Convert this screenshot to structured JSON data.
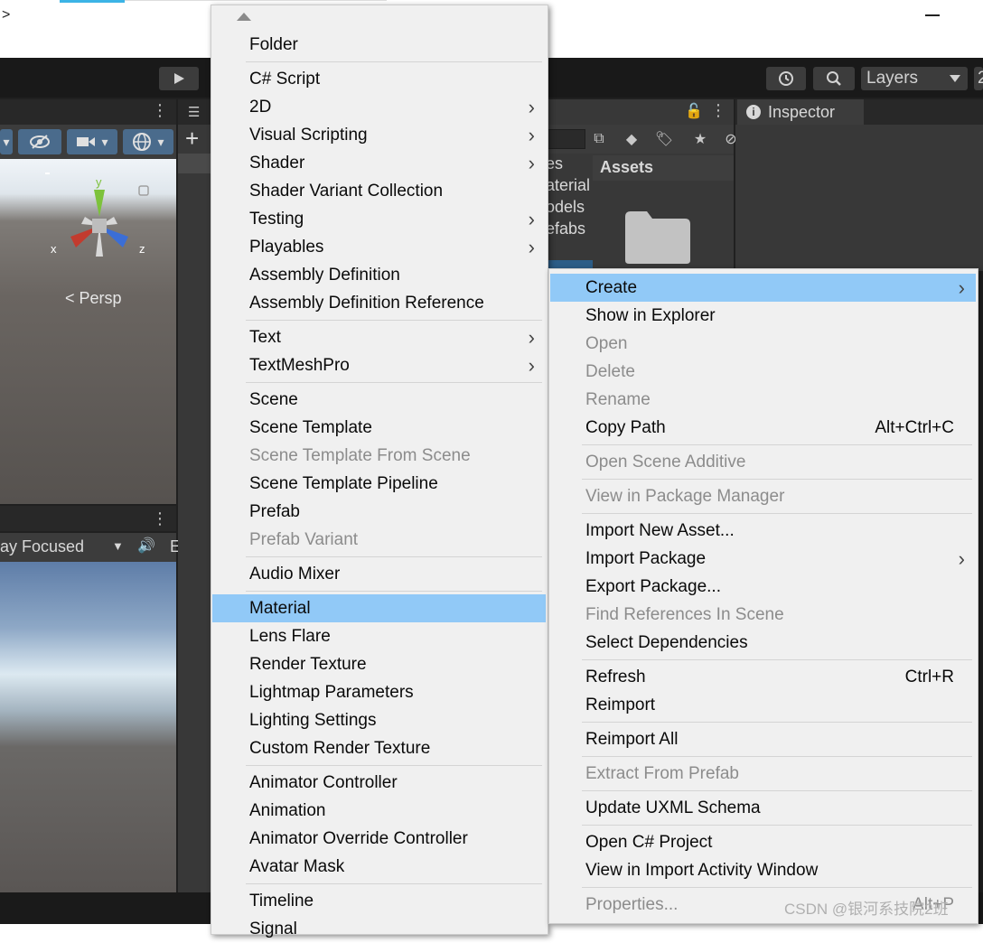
{
  "titlebar": {
    "caret": ">"
  },
  "toolbar": {
    "play_icon": "play-icon",
    "history_icon": "history-icon",
    "search_icon": "search-icon",
    "layers_label": "Layers",
    "layout_label": "2"
  },
  "scene": {
    "persp_label": "< Persp",
    "gizmo_axes": {
      "y": "y",
      "x": "x",
      "z": "z"
    }
  },
  "game": {
    "play_focused_label": "ay Focused",
    "extra_label": "E"
  },
  "project": {
    "tree_items": [
      "es",
      "aterial",
      "odels",
      "efabs"
    ],
    "assets_label": "Assets"
  },
  "inspector": {
    "tab_label": "Inspector"
  },
  "create_menu": {
    "items": [
      {
        "label": "Folder"
      },
      {
        "label": "C# Script"
      },
      {
        "label": "2D",
        "submenu": true
      },
      {
        "label": "Visual Scripting",
        "submenu": true
      },
      {
        "label": "Shader",
        "submenu": true
      },
      {
        "label": "Shader Variant Collection"
      },
      {
        "label": "Testing",
        "submenu": true
      },
      {
        "label": "Playables",
        "submenu": true
      },
      {
        "label": "Assembly Definition"
      },
      {
        "label": "Assembly Definition Reference"
      },
      {
        "label": "Text",
        "submenu": true
      },
      {
        "label": "TextMeshPro",
        "submenu": true
      },
      {
        "label": "Scene"
      },
      {
        "label": "Scene Template"
      },
      {
        "label": "Scene Template From Scene",
        "disabled": true
      },
      {
        "label": "Scene Template Pipeline"
      },
      {
        "label": "Prefab"
      },
      {
        "label": "Prefab Variant",
        "disabled": true
      },
      {
        "label": "Audio Mixer"
      },
      {
        "label": "Material",
        "highlighted": true
      },
      {
        "label": "Lens Flare"
      },
      {
        "label": "Render Texture"
      },
      {
        "label": "Lightmap Parameters"
      },
      {
        "label": "Lighting Settings"
      },
      {
        "label": "Custom Render Texture"
      },
      {
        "label": "Animator Controller"
      },
      {
        "label": "Animation"
      },
      {
        "label": "Animator Override Controller"
      },
      {
        "label": "Avatar Mask"
      },
      {
        "label": "Timeline"
      },
      {
        "label": "Signal"
      }
    ]
  },
  "context_menu": {
    "items": [
      {
        "label": "Create",
        "submenu": true,
        "highlighted": true
      },
      {
        "label": "Show in Explorer"
      },
      {
        "label": "Open",
        "disabled": true
      },
      {
        "label": "Delete",
        "disabled": true
      },
      {
        "label": "Rename",
        "disabled": true
      },
      {
        "label": "Copy Path",
        "shortcut": "Alt+Ctrl+C"
      },
      {
        "label": "Open Scene Additive",
        "disabled": true
      },
      {
        "label": "View in Package Manager",
        "disabled": true
      },
      {
        "label": "Import New Asset..."
      },
      {
        "label": "Import Package",
        "submenu": true
      },
      {
        "label": "Export Package..."
      },
      {
        "label": "Find References In Scene",
        "disabled": true
      },
      {
        "label": "Select Dependencies"
      },
      {
        "label": "Refresh",
        "shortcut": "Ctrl+R"
      },
      {
        "label": "Reimport"
      },
      {
        "label": "Reimport All"
      },
      {
        "label": "Extract From Prefab",
        "disabled": true
      },
      {
        "label": "Update UXML Schema"
      },
      {
        "label": "Open C# Project"
      },
      {
        "label": "View in Import Activity Window"
      },
      {
        "label": "Properties...",
        "disabled": true,
        "shortcut": "Alt+P"
      }
    ]
  },
  "watermark": "CSDN @银河系技院2班",
  "colors": {
    "menu_bg": "#f0f0f0",
    "menu_highlight": "#91c9f7",
    "disabled_text": "#8c8c8c",
    "editor_dark": "#202020"
  }
}
